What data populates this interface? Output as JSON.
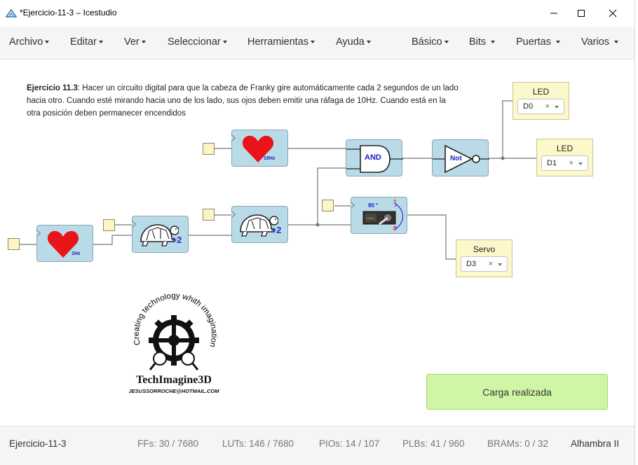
{
  "window": {
    "title": "*Ejercicio-11-3 – Icestudio"
  },
  "menu": {
    "left": [
      "Archivo",
      "Editar",
      "Ver",
      "Seleccionar",
      "Herramientas",
      "Ayuda"
    ],
    "right": [
      "Básico",
      "Bits",
      "Puertas",
      "Varios"
    ]
  },
  "description": {
    "bold": "Ejercicio 11.3",
    "text": ": Hacer un circuito digital para que la cabeza de Franky gire automáticamente cada 2 segundos de un lado hacia otro. Cuando esté mirando hacia uno de los lado, sus ojos deben emitir una ráfaga de 10Hz. Cuando está en la otra posición deben permanecer encendidos"
  },
  "blocks": {
    "heart_1hz": "1Hz",
    "heart_10hz": "10Hz",
    "div_label": "÷2",
    "and_label": "AND",
    "not_label": "Not",
    "servo_angle": "90 °",
    "servo_high": "1",
    "servo_low": "0"
  },
  "pins": {
    "led0": {
      "title": "LED",
      "value": "D0"
    },
    "led1": {
      "title": "LED",
      "value": "D1"
    },
    "servo": {
      "title": "Servo",
      "value": "D3"
    }
  },
  "logo": {
    "arc_text": "Creating technology whith imagination",
    "brand": "TechImagine3D",
    "email": "JESUSSORROCHE@HOTMAIL.COM"
  },
  "toast": "Carga realizada",
  "status": {
    "project": "Ejercicio-11-3",
    "ffs": "FFs:  30 / 7680",
    "luts": "LUTs:  146 / 7680",
    "pios": "PIOs:  14 / 107",
    "plbs": "PLBs:  41 / 960",
    "brams": "BRAMs:  0 / 32",
    "board": "Alhambra II"
  },
  "colors": {
    "block_fill": "#b9dbe8",
    "pin_fill": "#fdf8cb",
    "toast_fill": "#cff6a5",
    "heart": "#e8141a"
  }
}
